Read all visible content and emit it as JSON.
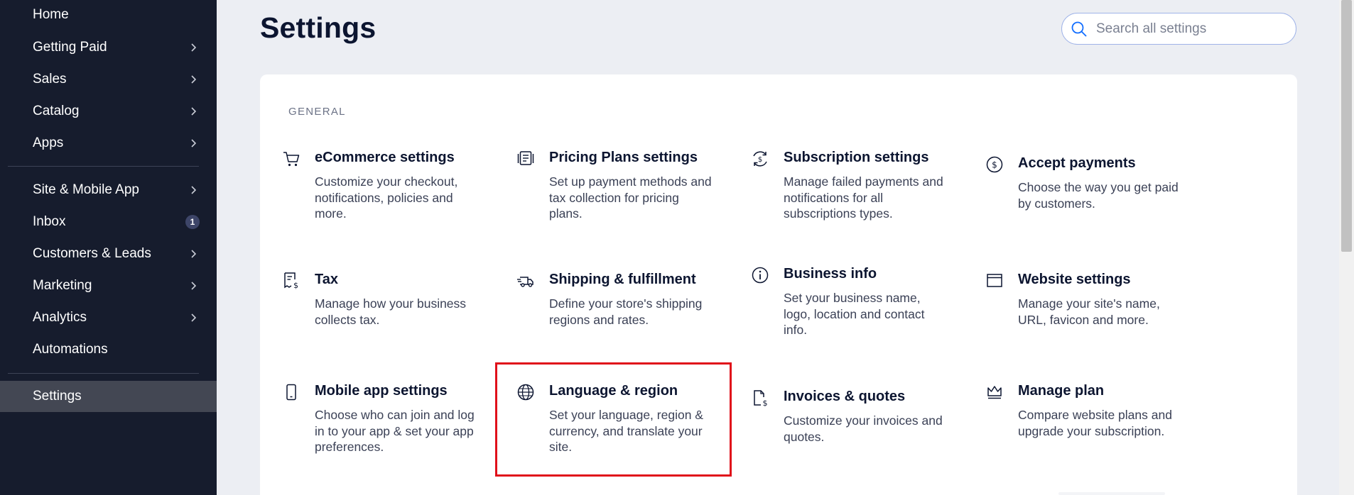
{
  "sidebar": {
    "items": [
      {
        "label": "Home",
        "chevron": false
      },
      {
        "label": "Getting Paid",
        "chevron": true
      },
      {
        "label": "Sales",
        "chevron": true
      },
      {
        "label": "Catalog",
        "chevron": true
      },
      {
        "label": "Apps",
        "chevron": true
      },
      {
        "label": "Site & Mobile App",
        "chevron": true
      },
      {
        "label": "Inbox",
        "badge": "1"
      },
      {
        "label": "Customers & Leads",
        "chevron": true
      },
      {
        "label": "Marketing",
        "chevron": true
      },
      {
        "label": "Analytics",
        "chevron": true
      },
      {
        "label": "Automations",
        "chevron": false
      },
      {
        "label": "Settings",
        "selected": true
      }
    ]
  },
  "header": {
    "title": "Settings",
    "search_placeholder": "Search all settings",
    "search_value": ""
  },
  "general": {
    "section_label": "GENERAL",
    "tiles": [
      {
        "icon": "cart-icon",
        "title": "eCommerce settings",
        "description": "Customize your checkout, notifications, policies and more."
      },
      {
        "icon": "pricing-plans-icon",
        "title": "Pricing Plans settings",
        "description": "Set up payment methods and tax collection for pricing plans."
      },
      {
        "icon": "subscription-icon",
        "title": "Subscription settings",
        "description": "Manage failed payments and notifications for all subscriptions types."
      },
      {
        "icon": "dollar-circle-icon",
        "title": "Accept payments",
        "description": "Choose the way you get paid by customers."
      },
      {
        "icon": "tax-receipt-icon",
        "title": "Tax",
        "description": "Manage how your business collects tax."
      },
      {
        "icon": "truck-icon",
        "title": "Shipping & fulfillment",
        "description": "Define your store's shipping regions and rates."
      },
      {
        "icon": "info-icon",
        "title": "Business info",
        "description": "Set your business name, logo, location and contact info."
      },
      {
        "icon": "browser-window-icon",
        "title": "Website settings",
        "description": "Manage your site's name, URL, favicon and more."
      },
      {
        "icon": "mobile-icon",
        "title": "Mobile app settings",
        "description": "Choose who can join and log in to your app & set your app preferences."
      },
      {
        "icon": "globe-icon",
        "title": "Language & region",
        "description": "Set your language, region & currency, and translate your site."
      },
      {
        "icon": "invoice-icon",
        "title": "Invoices & quotes",
        "description": "Customize your invoices and quotes."
      },
      {
        "icon": "crown-icon",
        "title": "Manage plan",
        "description": "Compare website plans and upgrade your subscription."
      }
    ]
  },
  "colors": {
    "sidebar_bg": "#161c2d",
    "sidebar_selected": "#434753",
    "page_bg": "#eceef3",
    "accent_blue": "#116dff",
    "highlight_red": "#e0101a"
  }
}
